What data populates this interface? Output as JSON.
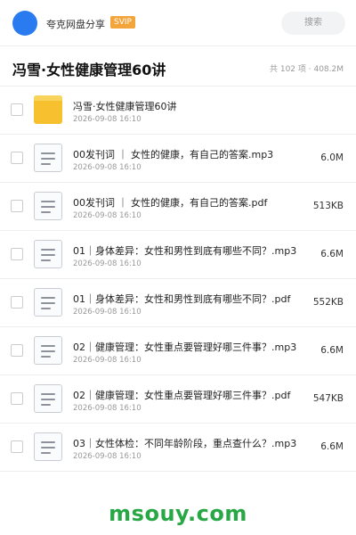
{
  "header": {
    "share_name": "夸克网盘分享",
    "badge": "SVIP",
    "search_placeholder": "搜索",
    "avatar_color": "#2b7bf0",
    "badge_color": "#f3a43a"
  },
  "folder": {
    "title": "冯雪·女性健康管理60讲",
    "meta": "共 102 项 · 408.2M"
  },
  "files": [
    {
      "icon": "folder-icon",
      "name": "冯雪·女性健康管理60讲",
      "date": "2026-09-08 16:10",
      "size": ""
    },
    {
      "icon": "document-icon",
      "name": "00发刊词 ｜ 女性的健康，有自己的答案.mp3",
      "date": "2026-09-08 16:10",
      "size": "6.0M"
    },
    {
      "icon": "document-icon",
      "name": "00发刊词 ｜ 女性的健康，有自己的答案.pdf",
      "date": "2026-09-08 16:10",
      "size": "513KB"
    },
    {
      "icon": "document-icon",
      "name": "01｜身体差异：女性和男性到底有哪些不同？.mp3",
      "date": "2026-09-08 16:10",
      "size": "6.6M"
    },
    {
      "icon": "document-icon",
      "name": "01｜身体差异：女性和男性到底有哪些不同？.pdf",
      "date": "2026-09-08 16:10",
      "size": "552KB"
    },
    {
      "icon": "document-icon",
      "name": "02｜健康管理：女性重点要管理好哪三件事？.mp3",
      "date": "2026-09-08 16:10",
      "size": "6.6M"
    },
    {
      "icon": "document-icon",
      "name": "02｜健康管理：女性重点要管理好哪三件事？.pdf",
      "date": "2026-09-08 16:10",
      "size": "547KB"
    },
    {
      "icon": "document-icon",
      "name": "03｜女性体检：不同年龄阶段，重点查什么？.mp3",
      "date": "2026-09-08 16:10",
      "size": "6.6M"
    }
  ],
  "watermark": "msouy.com"
}
